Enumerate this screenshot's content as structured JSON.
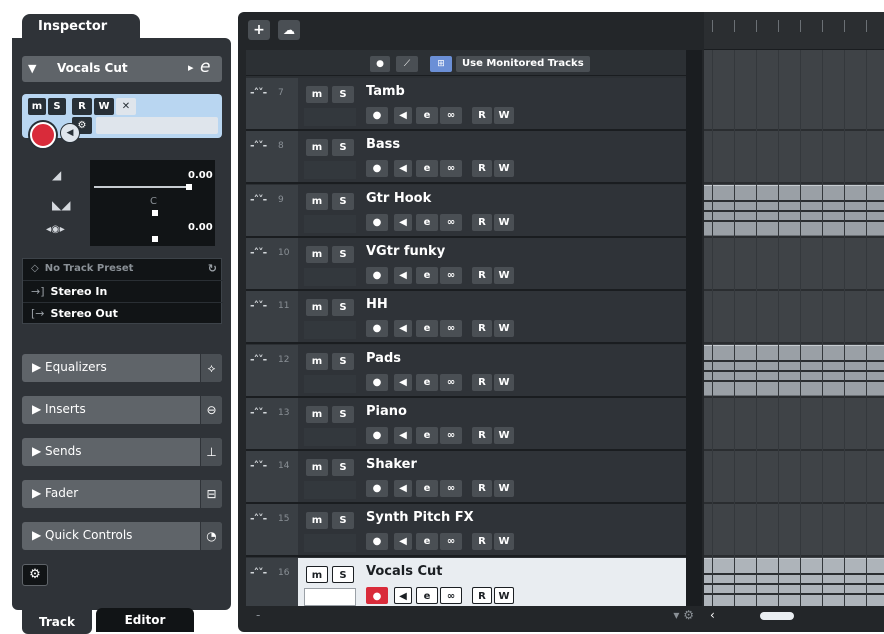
{
  "inspector": {
    "title": "Inspector",
    "track_name": "Vocals Cut",
    "volume_value": "0.00",
    "pan_value": "C",
    "delay_value": "0.00",
    "routing": {
      "preset": "No Track Preset",
      "input": "Stereo In",
      "output": "Stereo Out"
    },
    "sections": [
      {
        "label": "Equalizers",
        "icon": "eq-icon"
      },
      {
        "label": "Inserts",
        "icon": "inserts-icon"
      },
      {
        "label": "Sends",
        "icon": "sends-icon"
      },
      {
        "label": "Fader",
        "icon": "fader-icon"
      },
      {
        "label": "Quick Controls",
        "icon": "quick-controls-icon"
      }
    ],
    "buttons": {
      "m": "m",
      "s": "S",
      "r": "R",
      "w": "W"
    },
    "bottom_tabs": {
      "track": "Track",
      "editor": "Editor"
    }
  },
  "tracklist": {
    "global_label": "Use Monitored Tracks",
    "tracks": [
      {
        "num": "7",
        "name": "Tamb",
        "has_clip": false
      },
      {
        "num": "8",
        "name": "Bass",
        "has_clip": false
      },
      {
        "num": "9",
        "name": "Gtr Hook",
        "has_clip": true
      },
      {
        "num": "10",
        "name": "VGtr funky",
        "has_clip": false
      },
      {
        "num": "11",
        "name": "HH",
        "has_clip": false
      },
      {
        "num": "12",
        "name": "Pads",
        "has_clip": true
      },
      {
        "num": "13",
        "name": "Piano",
        "has_clip": false
      },
      {
        "num": "14",
        "name": "Shaker",
        "has_clip": false
      },
      {
        "num": "15",
        "name": "Synth Pitch FX",
        "has_clip": false
      },
      {
        "num": "16",
        "name": "Vocals Cut",
        "has_clip": true,
        "active": true
      }
    ],
    "buttons": {
      "m": "m",
      "s": "S",
      "r": "R",
      "w": "W"
    }
  },
  "colors": {
    "panel": "#2f3338",
    "selection_blue": "#b9d6f1",
    "record_red": "#d92b3a",
    "active_row": "#e9edf1"
  }
}
